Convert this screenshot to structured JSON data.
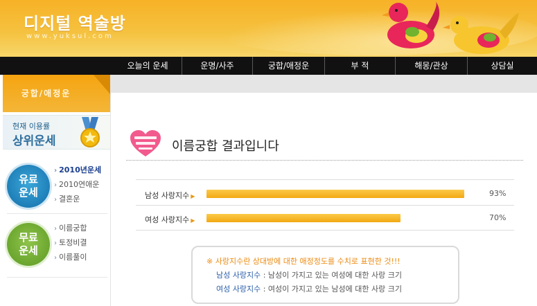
{
  "header": {
    "title": "디지털 역술방",
    "url": "www.yuksul.com"
  },
  "nav": {
    "items": [
      "오늘의 운세",
      "운명/사주",
      "궁합/애정운",
      "부 적",
      "해몽/관상",
      "상담실"
    ]
  },
  "sidebar": {
    "section_title": "궁합/애정운",
    "rank_line1": "현재 이용률",
    "rank_line2": "상위운세",
    "paid_badge": [
      "유료",
      "운세"
    ],
    "paid_items": [
      "2010년운세",
      "2010연애운",
      "결혼운"
    ],
    "free_badge": [
      "무료",
      "운세"
    ],
    "free_items": [
      "이름궁합",
      "토정비결",
      "이름풀이"
    ]
  },
  "main": {
    "title": "이름궁합 결과입니다",
    "results": [
      {
        "label": "남성 사랑지수",
        "percent": 93,
        "percent_text": "93%"
      },
      {
        "label": "여성 사랑지수",
        "percent": 70,
        "percent_text": "70%"
      }
    ],
    "note": {
      "line1": "※ 사랑지수란 상대방에 대한 애정정도를 수치로 표현한 것!!!",
      "line2_key": "남성 사랑지수",
      "line2_rest": " : 남성이 가지고 있는 여성에 대한 사랑 크기",
      "line3_key": "여성 사랑지수",
      "line3_rest": " : 여성이 가지고 있는 남성에 대한 사랑 크기"
    }
  },
  "colors": {
    "header": "#f5c13e",
    "nav_bg": "#111111",
    "bar_fill": "#f3a812",
    "note_highlight": "#ec8a10",
    "note_key": "#2a5ea8"
  },
  "icons": [
    "mandarin-ducks-illustration",
    "medal-icon",
    "love-badge-icon"
  ]
}
